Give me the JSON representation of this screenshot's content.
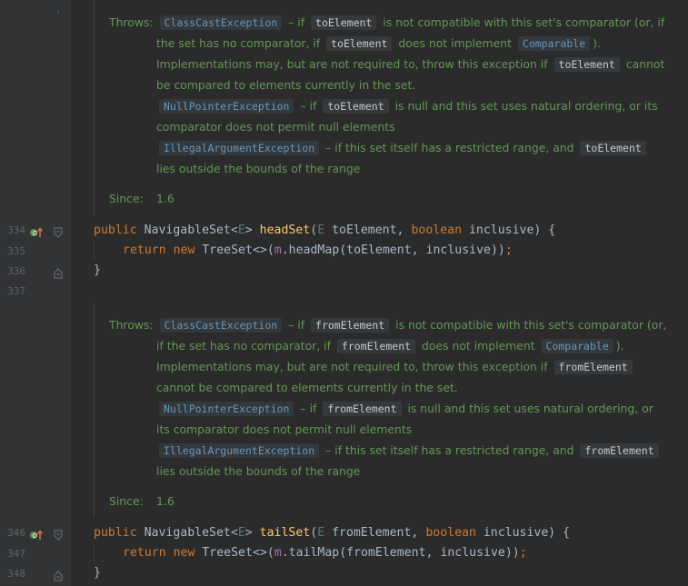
{
  "gutter": {
    "line_numbers": [
      "334",
      "335",
      "336",
      "337",
      "346",
      "347",
      "348"
    ]
  },
  "doc1": {
    "throws_label": "Throws:",
    "e1_name": "ClassCastException",
    "e1_t1": "– if",
    "e1_code1": "toElement",
    "e1_t2": "is not compatible with this set's comparator (or, if",
    "e1_t3": "the set has no comparator, if",
    "e1_code2": "toElement",
    "e1_t4": "does not implement",
    "e1_link": "Comparable",
    "e1_t5": ").",
    "e1_t6": "Implementations may, but are not required to, throw this exception if",
    "e1_code3": "toElement",
    "e1_t7": "cannot",
    "e1_t8": "be compared to elements currently in the set.",
    "e2_name": "NullPointerException",
    "e2_t1": "– if",
    "e2_code": "toElement",
    "e2_t2": "is null and this set uses natural ordering, or its",
    "e2_t3": "comparator does not permit null elements",
    "e3_name": "IllegalArgumentException",
    "e3_t1": "– if this set itself has a restricted range, and",
    "e3_code": "toElement",
    "e3_t2": "lies outside the bounds of the range",
    "since_label": "Since:",
    "since_value": "1.6"
  },
  "code1": {
    "l1_kw": "public",
    "l1_type": "NavigableSet",
    "l1_lt": "<",
    "l1_E": "E",
    "l1_gt": "> ",
    "l1_name": "headSet",
    "l1_open": "(",
    "l1_E2": "E",
    "l1_p1": " toElement, ",
    "l1_bool": "boolean",
    "l1_p2": " inclusive) {",
    "l2_ret": "return",
    "l2_new": "new",
    "l2_type": " TreeSet<>(",
    "l2_m": "m",
    "l2_call": ".headMap(toElement, inclusive))",
    "l2_semi": ";",
    "l3": "}"
  },
  "doc2": {
    "throws_label": "Throws:",
    "e1_name": "ClassCastException",
    "e1_t1": "– if",
    "e1_code1": "fromElement",
    "e1_t2": "is not compatible with this set's comparator (or,",
    "e1_t3": "if the set has no comparator, if",
    "e1_code2": "fromElement",
    "e1_t4": "does not implement",
    "e1_link": "Comparable",
    "e1_t5": ").",
    "e1_t6": "Implementations may, but are not required to, throw this exception if",
    "e1_code3": "fromElement",
    "e1_t8": "cannot be compared to elements currently in the set.",
    "e2_name": "NullPointerException",
    "e2_t1": "– if",
    "e2_code": "fromElement",
    "e2_t2": "is null and this set uses natural ordering, or",
    "e2_t3": "its comparator does not permit null elements",
    "e3_name": "IllegalArgumentException",
    "e3_t1": "– if this set itself has a restricted range, and",
    "e3_code": "fromElement",
    "e3_t2": "lies outside the bounds of the range",
    "since_label": "Since:",
    "since_value": "1.6"
  },
  "code2": {
    "l1_kw": "public",
    "l1_type": "NavigableSet",
    "l1_lt": "<",
    "l1_E": "E",
    "l1_gt": "> ",
    "l1_name": "tailSet",
    "l1_open": "(",
    "l1_E2": "E",
    "l1_p1": " fromElement, ",
    "l1_bool": "boolean",
    "l1_p2": " inclusive) {",
    "l2_ret": "return",
    "l2_new": "new",
    "l2_type": " TreeSet<>(",
    "l2_m": "m",
    "l2_call": ".tailMap(fromElement, inclusive))",
    "l2_semi": ";",
    "l3": "}"
  },
  "icons": {
    "override": "override-gutter-icon",
    "fold": "fold-marker-icon"
  }
}
